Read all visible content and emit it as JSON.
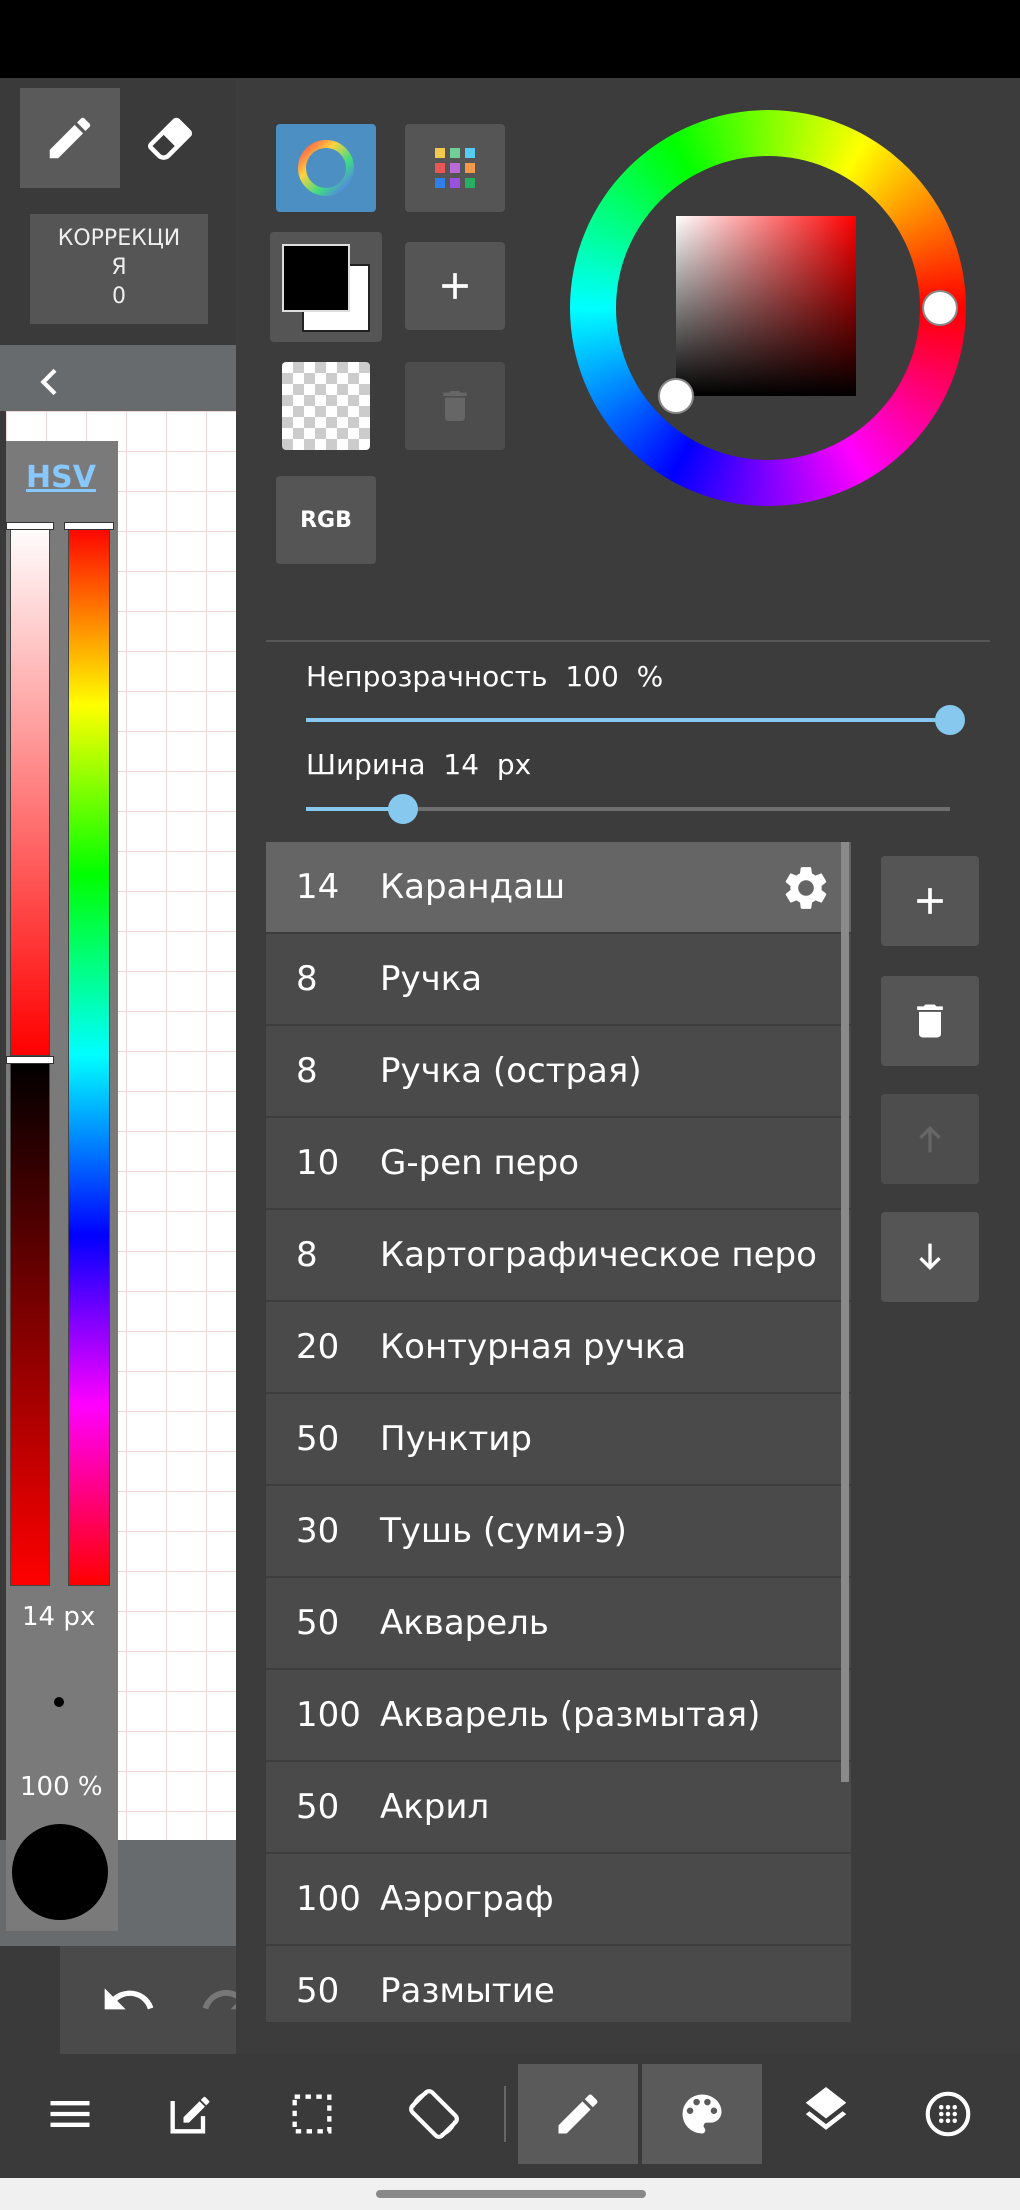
{
  "left": {
    "correction_label": "КОРРЕКЦИ\nЯ\n0",
    "hsv_label": "HSV",
    "size_label": "14 px",
    "opacity_label": "100 %"
  },
  "color_panel": {
    "rgb_label": "RGB",
    "opacity_label": "Непрозрачность",
    "opacity_value": "100",
    "opacity_unit": "%",
    "opacity_fraction": 1.0,
    "width_label": "Ширина",
    "width_value": "14",
    "width_unit": "px",
    "width_fraction": 0.15,
    "current_color": "#000000"
  },
  "brushes": [
    {
      "size": "14",
      "name": "Карандаш"
    },
    {
      "size": "8",
      "name": "Ручка"
    },
    {
      "size": "8",
      "name": "Ручка (острая)"
    },
    {
      "size": "10",
      "name": "G-pen перо"
    },
    {
      "size": "8",
      "name": "Картографическое перо"
    },
    {
      "size": "20",
      "name": "Контурная ручка"
    },
    {
      "size": "50",
      "name": "Пунктир"
    },
    {
      "size": "30",
      "name": "Тушь (суми-э)"
    },
    {
      "size": "50",
      "name": "Акварель"
    },
    {
      "size": "100",
      "name": "Акварель (размытая)"
    },
    {
      "size": "50",
      "name": "Акрил"
    },
    {
      "size": "100",
      "name": "Аэрограф"
    },
    {
      "size": "50",
      "name": "Размытие"
    }
  ],
  "colors": {
    "accent": "#87c8ee",
    "selected_tool_bg": "#656565"
  }
}
